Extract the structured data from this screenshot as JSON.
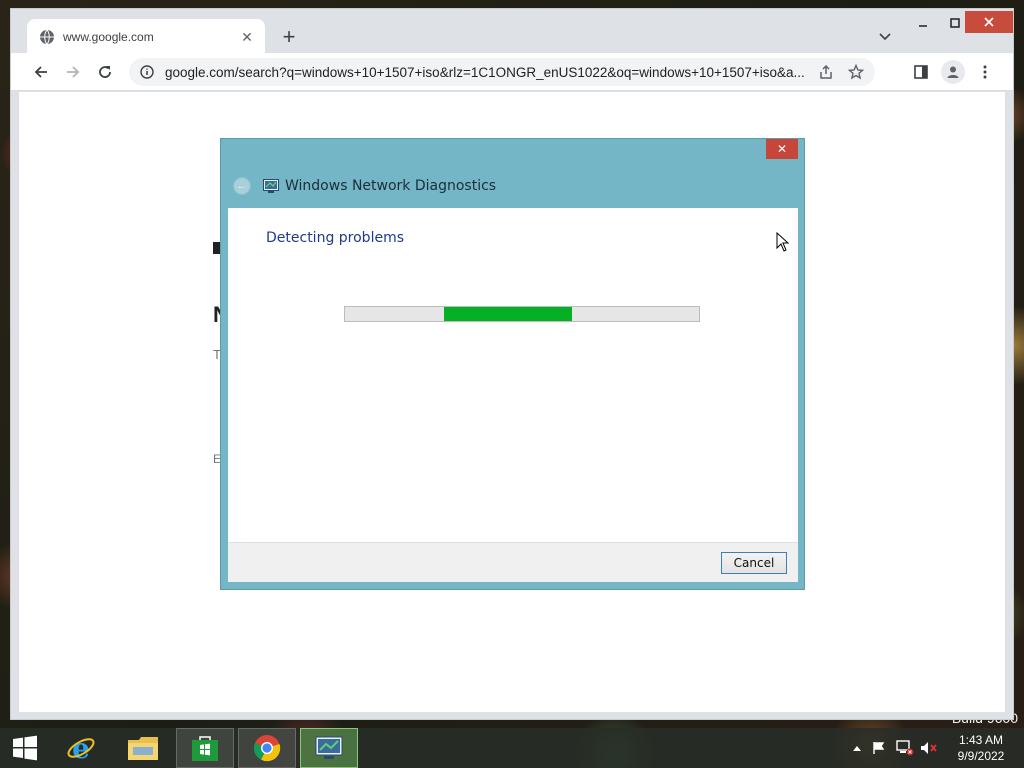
{
  "browser": {
    "tab": {
      "title": "www.google.com"
    },
    "url": "google.com/search?q=windows+10+1507+iso&rlz=1C1ONGR_enUS1022&oq=windows+10+1507+iso&a..."
  },
  "desktop": {
    "build_text": "Build 9600"
  },
  "dialog": {
    "title": "Windows Network Diagnostics",
    "heading": "Detecting problems",
    "progress": {
      "start": 0.28,
      "end": 0.64,
      "color": "#06b025"
    },
    "cancel_label": "Cancel",
    "close_glyph": "✕"
  },
  "taskbar": {
    "items": [
      "start",
      "internet-explorer",
      "file-explorer",
      "store",
      "chrome",
      "network-diagnostics"
    ],
    "clock": {
      "time": "1:43 AM",
      "date": "9/9/2022"
    }
  },
  "colors": {
    "dialog_frame": "#75b6c6",
    "close_red": "#c7463a",
    "heading_blue": "#1f3a8a"
  }
}
